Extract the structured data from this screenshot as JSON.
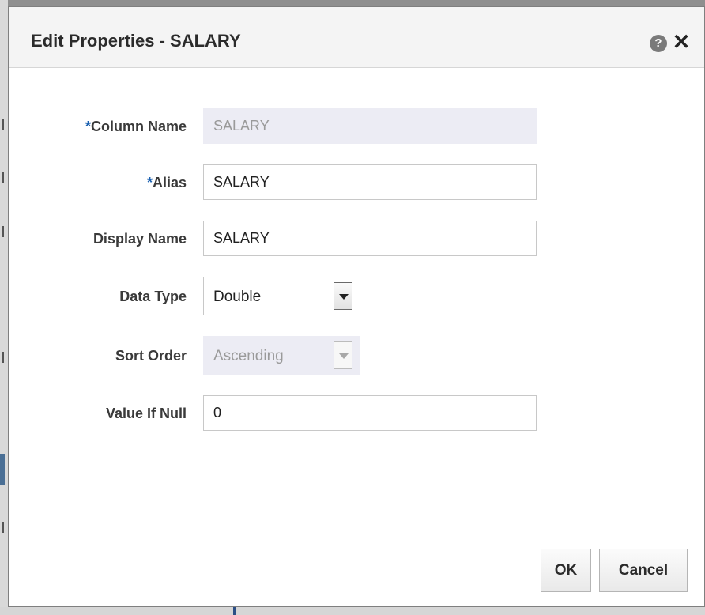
{
  "dialog": {
    "title": "Edit Properties - SALARY"
  },
  "form": {
    "required_marker": "*",
    "column_name": {
      "label": "Column Name",
      "required": true,
      "value": "SALARY",
      "disabled": true
    },
    "alias": {
      "label": "Alias",
      "required": true,
      "value": "SALARY"
    },
    "display_name": {
      "label": "Display Name",
      "value": "SALARY"
    },
    "data_type": {
      "label": "Data Type",
      "value": "Double"
    },
    "sort_order": {
      "label": "Sort Order",
      "value": "Ascending",
      "disabled": true
    },
    "value_if_null": {
      "label": "Value If Null",
      "value": "0"
    }
  },
  "buttons": {
    "ok_label": "OK",
    "cancel_label": "Cancel"
  },
  "icons": {
    "help": "help-icon",
    "close": "close-icon",
    "dropdown": "chevron-down-icon"
  },
  "colors": {
    "required_marker": "#1a60b0",
    "disabled_field": "#ececf4"
  }
}
